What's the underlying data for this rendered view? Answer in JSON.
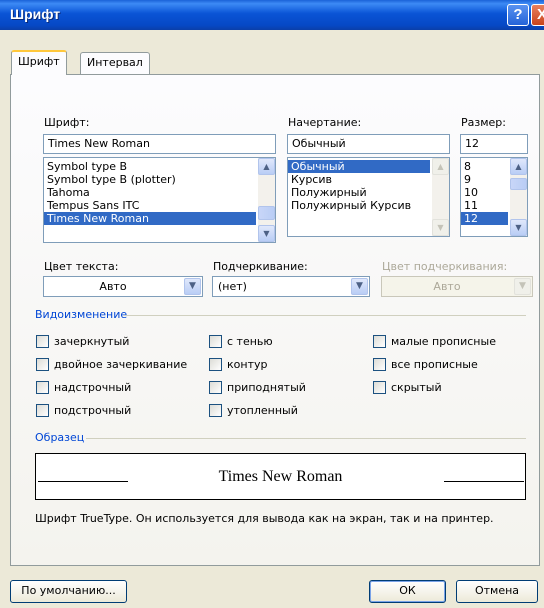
{
  "window": {
    "title": "Шрифт",
    "help_glyph": "?",
    "close_glyph": "X"
  },
  "tabs": [
    {
      "label": "Шрифт",
      "active": true
    },
    {
      "label": "Интервал",
      "active": false
    }
  ],
  "font": {
    "label": "Шрифт:",
    "value": "Times New Roman",
    "items": [
      "Symbol type B",
      "Symbol type B (plotter)",
      "Tahoma",
      "Tempus Sans ITC",
      "Times New Roman"
    ],
    "selected": "Times New Roman"
  },
  "style": {
    "label": "Начертание:",
    "value": "Обычный",
    "items": [
      "Обычный",
      "Курсив",
      "Полужирный",
      "Полужирный Курсив"
    ],
    "selected": "Обычный"
  },
  "size": {
    "label": "Размер:",
    "value": "12",
    "items": [
      "8",
      "9",
      "10",
      "11",
      "12"
    ],
    "selected": "12"
  },
  "text_color": {
    "label": "Цвет текста:",
    "value": "Авто"
  },
  "underline": {
    "label": "Подчеркивание:",
    "value": "(нет)"
  },
  "underline_color": {
    "label": "Цвет подчеркивания:",
    "value": "Авто",
    "enabled": false
  },
  "effects": {
    "title": "Видоизменение",
    "items": [
      "зачеркнутый",
      "двойное зачеркивание",
      "надстрочный",
      "подстрочный",
      "с тенью",
      "контур",
      "приподнятый",
      "утопленный",
      "малые прописные",
      "все прописные",
      "скрытый"
    ]
  },
  "preview": {
    "title": "Образец",
    "sample": "Times New Roman",
    "note": "Шрифт TrueType. Он используется для вывода как на экран, так и на принтер."
  },
  "buttons": {
    "default": "По умолчанию...",
    "ok": "ОК",
    "cancel": "Отмена"
  },
  "colors": {
    "title_bar": "#0a54d6",
    "selection": "#316ac5",
    "group_title": "#0046d5",
    "dialog_bg": "#ece9d8"
  }
}
